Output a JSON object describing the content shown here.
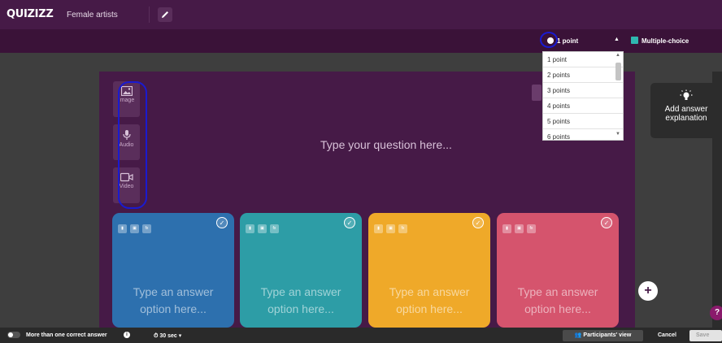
{
  "header": {
    "logo": "QUIZIZZ",
    "quiz_title": "Female artists"
  },
  "points_select": {
    "selected": "1 point",
    "options": [
      "1 point",
      "2 points",
      "3 points",
      "4 points",
      "5 points",
      "6 points"
    ]
  },
  "question_type": {
    "selected": "Multiple-choice"
  },
  "media_buttons": [
    {
      "label": "Image"
    },
    {
      "label": "Audio"
    },
    {
      "label": "Video"
    }
  ],
  "question": {
    "placeholder": "Type your question here..."
  },
  "answer_options": [
    {
      "text": "Type an answer option here...",
      "color": "#2d70ae"
    },
    {
      "text": "Type an answer option here...",
      "color": "#2d9da6"
    },
    {
      "text": "Type an answer option here...",
      "color": "#efa929"
    },
    {
      "text": "Type an answer option here...",
      "color": "#d5546d"
    }
  ],
  "explanation": {
    "label": "Add answer explanation"
  },
  "footer": {
    "multi_correct_label": "More than one correct answer",
    "timer": "30 sec",
    "participants_view": "Participants' view",
    "cancel": "Cancel",
    "save": "Save"
  },
  "colors": {
    "header_bg": "#461a47",
    "canvas_bg": "#461a47",
    "page_bg": "#3e3e3e",
    "annotation": "#1a1ad0"
  }
}
